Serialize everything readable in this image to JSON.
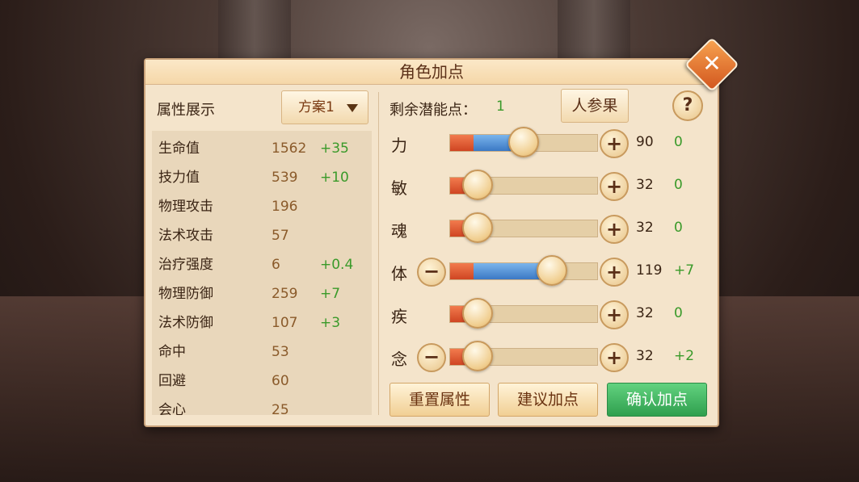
{
  "dialog": {
    "title": "角色加点",
    "close_symbol": "✕"
  },
  "left": {
    "header": "属性展示",
    "scheme": {
      "label": "方案1"
    },
    "stats": [
      {
        "name": "生命值",
        "value": "1562",
        "bonus": "+35"
      },
      {
        "name": "技力值",
        "value": "539",
        "bonus": "+10"
      },
      {
        "name": "物理攻击",
        "value": "196",
        "bonus": ""
      },
      {
        "name": "法术攻击",
        "value": "57",
        "bonus": ""
      },
      {
        "name": "治疗强度",
        "value": "6",
        "bonus": "+0.4"
      },
      {
        "name": "物理防御",
        "value": "259",
        "bonus": "+7"
      },
      {
        "name": "法术防御",
        "value": "107",
        "bonus": "+3"
      },
      {
        "name": "命中",
        "value": "53",
        "bonus": ""
      },
      {
        "name": "回避",
        "value": "60",
        "bonus": ""
      },
      {
        "name": "会心",
        "value": "25",
        "bonus": ""
      }
    ]
  },
  "right": {
    "remaining_label": "剩余潜能点：",
    "remaining_value": "1",
    "ginseng_label": "人参果",
    "help_symbol": "?",
    "attributes": [
      {
        "name": "力",
        "value": "90",
        "added": "0",
        "has_minus": false,
        "base_fraction": 0.16,
        "added_fraction": 0.31
      },
      {
        "name": "敏",
        "value": "32",
        "added": "0",
        "has_minus": false,
        "base_fraction": 0.16,
        "added_fraction": 0.0
      },
      {
        "name": "魂",
        "value": "32",
        "added": "0",
        "has_minus": false,
        "base_fraction": 0.16,
        "added_fraction": 0.0
      },
      {
        "name": "体",
        "value": "119",
        "added": "+7",
        "has_minus": true,
        "base_fraction": 0.16,
        "added_fraction": 0.5
      },
      {
        "name": "疾",
        "value": "32",
        "added": "0",
        "has_minus": false,
        "base_fraction": 0.16,
        "added_fraction": 0.0
      },
      {
        "name": "念",
        "value": "32",
        "added": "+2",
        "has_minus": true,
        "base_fraction": 0.16,
        "added_fraction": 0.0
      }
    ],
    "plus_symbol": "+",
    "minus_symbol": "−"
  },
  "buttons": {
    "reset": "重置属性",
    "suggest": "建议加点",
    "confirm": "确认加点"
  },
  "colors": {
    "panel_bg": "#f4e4cb",
    "positive_green": "#3a9a2a",
    "confirm_green": "#2f9f4e",
    "bar_red": "#cf4522",
    "bar_blue": "#3b78c4",
    "close_orange": "#d2561e"
  }
}
